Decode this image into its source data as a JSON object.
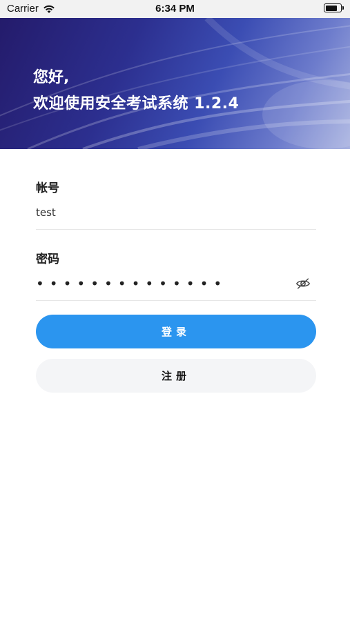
{
  "status_bar": {
    "carrier": "Carrier",
    "time": "6:34 PM",
    "battery_level": 0.8
  },
  "banner": {
    "greeting": "您好,",
    "welcome": "欢迎使用安全考试系统 1.2.4"
  },
  "form": {
    "account_label": "帐号",
    "account_value": "test",
    "password_label": "密码",
    "password_masked": "••••••••••••••",
    "toggle_icon": "eye-off-icon"
  },
  "actions": {
    "login_label": "登录",
    "register_label": "注册"
  },
  "colors": {
    "primary": "#2b95ef",
    "secondary_bg": "#f4f5f7",
    "banner_dark": "#241b6b"
  }
}
